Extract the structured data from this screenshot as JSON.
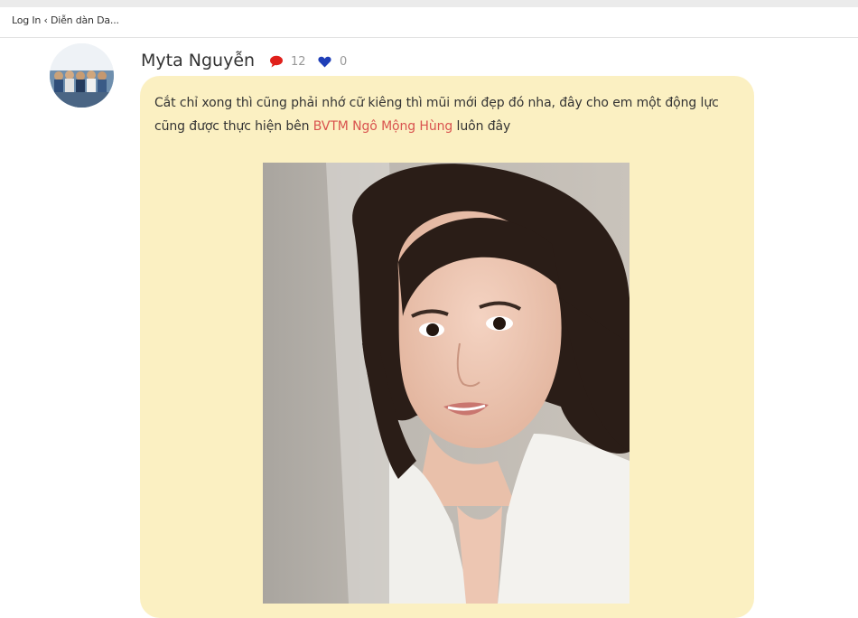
{
  "browser": {
    "tab_title": "Log In ‹ Diễn dàn Da..."
  },
  "post": {
    "author": "Myta Nguyễn",
    "comment_count": "12",
    "like_count": "0",
    "text_before_link": "Cắt chỉ xong thì cũng phải nhớ cữ kiêng thì mũi mới đẹp đó nha, đây cho em một động lực cũng được thực hiện bên ",
    "link_text": "BVTM Ngô Mộng Hùng",
    "text_after_link": " luôn đây"
  },
  "icons": {
    "comment": "speech-bubble-icon",
    "like": "heart-icon"
  },
  "colors": {
    "bubble_background": "#fbf0c2",
    "link": "#d9534f",
    "comment_icon": "#e0201b",
    "heart_icon": "#1f3fb8",
    "count_text": "#999999"
  }
}
